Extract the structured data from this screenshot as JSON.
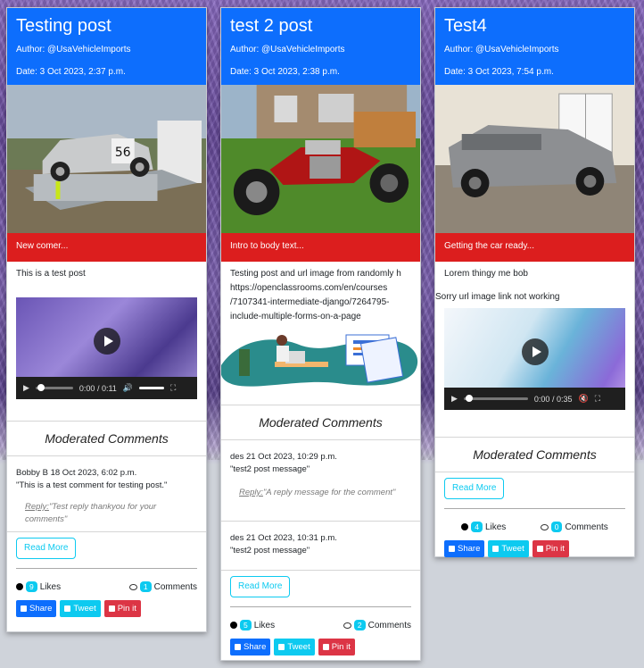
{
  "posts": [
    {
      "title": "Testing post",
      "author": "Author: @UsaVehicleImports",
      "date": "Date: 3 Oct 2023, 2:37 p.m.",
      "excerpt": "New comer...",
      "body": "This is a test post",
      "video": {
        "time": "0:00 / 0:11"
      },
      "comments_heading": "Moderated Comments",
      "comments": [
        {
          "author": "Bobby B",
          "date": "18 Oct 2023, 6:02 p.m.",
          "text": "\"This is a test comment for testing post.\"",
          "reply_label": "Reply:",
          "reply_text": "\"Test reply thankyou for your comments\""
        }
      ],
      "read_more": "Read More",
      "likes_count": "9",
      "likes_label": "Likes",
      "comments_count": "1",
      "comments_label": "Comments",
      "share": "Share",
      "tweet": "Tweet",
      "pin": "Pin it"
    },
    {
      "title": "test 2 post",
      "author": "Author: @UsaVehicleImports",
      "date": "Date: 3 Oct 2023, 2:38 p.m.",
      "excerpt": "Intro to body text...",
      "body_lines": [
        "Testing post and url image from randomly h",
        "https://openclassrooms.com/en/courses",
        "/7107341-intermediate-django/7264795-",
        "include-multiple-forms-on-a-page"
      ],
      "comments_heading": "Moderated Comments",
      "comments": [
        {
          "author": "des",
          "date": "21 Oct 2023, 10:29 p.m.",
          "text": "\"test2 post message\"",
          "reply_label": "Reply:",
          "reply_text": "\"A reply message for the comment\""
        },
        {
          "author": "des",
          "date": "21 Oct 2023, 10:31 p.m.",
          "text": "\"test2 post message\""
        }
      ],
      "read_more": "Read More",
      "likes_count": "5",
      "likes_label": "Likes",
      "comments_count": "2",
      "comments_label": "Comments",
      "share": "Share",
      "tweet": "Tweet",
      "pin": "Pin it"
    },
    {
      "title": "Test4",
      "author": "Author: @UsaVehicleImports",
      "date": "Date: 3 Oct 2023, 7:54 p.m.",
      "excerpt": "Getting the car ready...",
      "body": "Lorem thingy me bob",
      "body2": "Sorry url image link not working",
      "video": {
        "time": "0:00 / 0:35"
      },
      "comments_heading": "Moderated Comments",
      "read_more": "Read More",
      "likes_count": "4",
      "likes_label": "Likes",
      "comments_count": "0",
      "comments_label": "Comments",
      "share": "Share",
      "tweet": "Tweet",
      "pin": "Pin it"
    }
  ],
  "colors": {
    "header": "#0d6efd",
    "excerpt": "#dc1e1e",
    "info": "#0dcaf0",
    "danger": "#dc3545"
  },
  "icons": [
    "heart-icon",
    "comment-icon",
    "facebook-icon",
    "twitter-icon",
    "pinterest-icon",
    "play-icon",
    "volume-icon",
    "fullscreen-icon"
  ]
}
